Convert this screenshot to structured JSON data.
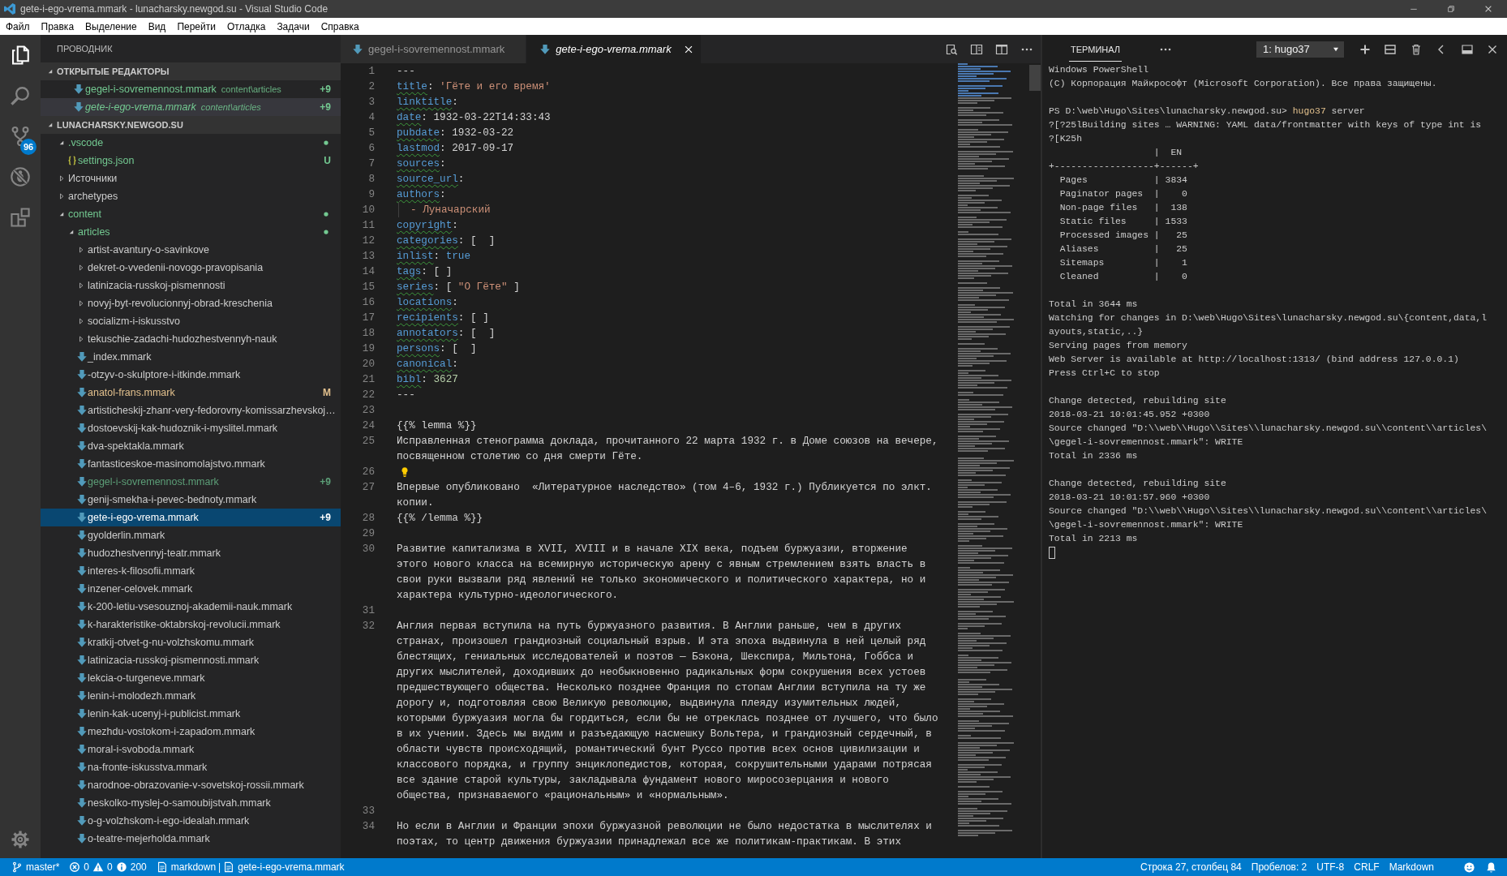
{
  "window": {
    "title": "gete-i-ego-vrema.mmark - lunacharsky.newgod.su - Visual Studio Code"
  },
  "menu": [
    "Файл",
    "Правка",
    "Выделение",
    "Вид",
    "Перейти",
    "Отладка",
    "Задачи",
    "Справка"
  ],
  "activity_bar": {
    "items": [
      {
        "kind": "explorer",
        "selected": true
      },
      {
        "kind": "search",
        "selected": false
      },
      {
        "kind": "scm",
        "selected": false,
        "badge": "96"
      },
      {
        "kind": "debug",
        "selected": false
      },
      {
        "kind": "extensions",
        "selected": false
      }
    ]
  },
  "sidebar": {
    "title": "ПРОВОДНИК",
    "open_editors": {
      "title": "ОТКРЫТЫЕ РЕДАКТОРЫ",
      "expanded": true,
      "items": [
        {
          "label": "gegel-i-sovremennost.mmark",
          "path": "content\\articles",
          "badge": "+9",
          "color": "#73c991",
          "preview": false,
          "selected": false
        },
        {
          "label": "gete-i-ego-vrema.mmark",
          "path": "content\\articles",
          "badge": "+9",
          "color": "#73c991",
          "preview": true,
          "selected": true
        }
      ]
    },
    "project": {
      "title": "LUNACHARSKY.NEWGOD.SU",
      "expanded": true,
      "tree": [
        {
          "label": ".vscode",
          "kind": "folder",
          "expanded": true,
          "dot": true,
          "color": "#73c991",
          "selected": false,
          "children": [
            {
              "label": "settings.json",
              "kind": "json",
              "color": "#73c991",
              "badge": "U",
              "selected": false
            }
          ]
        },
        {
          "label": "Источники",
          "kind": "folder",
          "expanded": false,
          "dot": false,
          "color": "#cccccc",
          "selected": false
        },
        {
          "label": "archetypes",
          "kind": "folder",
          "expanded": false,
          "dot": false,
          "color": "#cccccc",
          "selected": false
        },
        {
          "label": "content",
          "kind": "folder",
          "expanded": true,
          "dot": true,
          "color": "#73c991",
          "selected": false,
          "children": [
            {
              "label": "articles",
              "kind": "folder",
              "expanded": true,
              "dot": true,
              "color": "#73c991",
              "selected": false,
              "children": [
                {
                  "label": "artist-avantury-o-savinkove",
                  "kind": "folder",
                  "expanded": false,
                  "dot": false,
                  "color": "#cccccc",
                  "selected": false
                },
                {
                  "label": "dekret-o-vvedenii-novogo-pravopisania",
                  "kind": "folder",
                  "expanded": false,
                  "dot": false,
                  "color": "#cccccc",
                  "selected": false
                },
                {
                  "label": "latinizacia-russkoj-pismennosti",
                  "kind": "folder",
                  "expanded": false,
                  "dot": false,
                  "color": "#cccccc",
                  "selected": false
                },
                {
                  "label": "novyj-byt-revolucionnyj-obrad-kreschenia",
                  "kind": "folder",
                  "expanded": false,
                  "dot": false,
                  "color": "#cccccc",
                  "selected": false
                },
                {
                  "label": "socializm-i-iskusstvo",
                  "kind": "folder",
                  "expanded": false,
                  "dot": false,
                  "color": "#cccccc",
                  "selected": false
                },
                {
                  "label": "tekuschie-zadachi-hudozhestvennyh-nauk",
                  "kind": "folder",
                  "expanded": false,
                  "dot": false,
                  "color": "#cccccc",
                  "selected": false
                },
                {
                  "label": "_index.mmark",
                  "kind": "markdown",
                  "color": "#cccccc",
                  "selected": false
                },
                {
                  "label": "-otzyv-o-skulptore-i-itkinde.mmark",
                  "kind": "markdown",
                  "color": "#cccccc",
                  "selected": false
                },
                {
                  "label": "anatol-frans.mmark",
                  "kind": "markdown",
                  "color": "#e2c08d",
                  "badge": "M",
                  "selected": false
                },
                {
                  "label": "artisticheskij-zhanr-very-fedorovny-komissarzhevskoj…",
                  "kind": "markdown",
                  "color": "#cccccc",
                  "selected": false
                },
                {
                  "label": "dostoevskij-kak-hudoznik-i-myslitel.mmark",
                  "kind": "markdown",
                  "color": "#cccccc",
                  "selected": false
                },
                {
                  "label": "dva-spektakla.mmark",
                  "kind": "markdown",
                  "color": "#cccccc",
                  "selected": false
                },
                {
                  "label": "fantasticeskoe-masinomolajstvo.mmark",
                  "kind": "markdown",
                  "color": "#cccccc",
                  "selected": false
                },
                {
                  "label": "gegel-i-sovremennost.mmark",
                  "kind": "markdown",
                  "color": "#5c9e77",
                  "badge": "+9",
                  "selected": false
                },
                {
                  "label": "genij-smekha-i-pevec-bednoty.mmark",
                  "kind": "markdown",
                  "color": "#cccccc",
                  "selected": false
                },
                {
                  "label": "gete-i-ego-vrema.mmark",
                  "kind": "markdown",
                  "color": "#ffffff",
                  "badge": "+9",
                  "selected": true
                },
                {
                  "label": "gyolderlin.mmark",
                  "kind": "markdown",
                  "color": "#cccccc",
                  "selected": false
                },
                {
                  "label": "hudozhestvennyj-teatr.mmark",
                  "kind": "markdown",
                  "color": "#cccccc",
                  "selected": false
                },
                {
                  "label": "interes-k-filosofii.mmark",
                  "kind": "markdown",
                  "color": "#cccccc",
                  "selected": false
                },
                {
                  "label": "inzener-celovek.mmark",
                  "kind": "markdown",
                  "color": "#cccccc",
                  "selected": false
                },
                {
                  "label": "k-200-letiu-vsesouznoj-akademii-nauk.mmark",
                  "kind": "markdown",
                  "color": "#cccccc",
                  "selected": false
                },
                {
                  "label": "k-harakteristike-oktabrskoj-revolucii.mmark",
                  "kind": "markdown",
                  "color": "#cccccc",
                  "selected": false
                },
                {
                  "label": "kratkij-otvet-g-nu-volzhskomu.mmark",
                  "kind": "markdown",
                  "color": "#cccccc",
                  "selected": false
                },
                {
                  "label": "latinizacia-russkoj-pismennosti.mmark",
                  "kind": "markdown",
                  "color": "#cccccc",
                  "selected": false
                },
                {
                  "label": "lekcia-o-turgeneve.mmark",
                  "kind": "markdown",
                  "color": "#cccccc",
                  "selected": false
                },
                {
                  "label": "lenin-i-molodezh.mmark",
                  "kind": "markdown",
                  "color": "#cccccc",
                  "selected": false
                },
                {
                  "label": "lenin-kak-ucenyj-i-publicist.mmark",
                  "kind": "markdown",
                  "color": "#cccccc",
                  "selected": false
                },
                {
                  "label": "mezhdu-vostokom-i-zapadom.mmark",
                  "kind": "markdown",
                  "color": "#cccccc",
                  "selected": false
                },
                {
                  "label": "moral-i-svoboda.mmark",
                  "kind": "markdown",
                  "color": "#cccccc",
                  "selected": false
                },
                {
                  "label": "na-fronte-iskusstva.mmark",
                  "kind": "markdown",
                  "color": "#cccccc",
                  "selected": false
                },
                {
                  "label": "narodnoe-obrazovanie-v-sovetskoj-rossii.mmark",
                  "kind": "markdown",
                  "color": "#cccccc",
                  "selected": false
                },
                {
                  "label": "neskolko-myslej-o-samoubijstvah.mmark",
                  "kind": "markdown",
                  "color": "#cccccc",
                  "selected": false
                },
                {
                  "label": "o-g-volzhskom-i-ego-idealah.mmark",
                  "kind": "markdown",
                  "color": "#cccccc",
                  "selected": false
                },
                {
                  "label": "o-teatre-mejerholda.mmark",
                  "kind": "markdown",
                  "color": "#cccccc",
                  "selected": false
                }
              ]
            }
          ]
        }
      ]
    }
  },
  "editor": {
    "tabs": [
      {
        "label": "gegel-i-sovremennost.mmark",
        "selected": false,
        "preview": false
      },
      {
        "label": "gete-i-ego-vrema.mmark",
        "selected": true,
        "preview": true
      }
    ],
    "lines": [
      {
        "number": "1",
        "tokens": [
          {
            "kind": "plain",
            "text": "---"
          }
        ]
      },
      {
        "number": "2",
        "tokens": [
          {
            "kind": "key",
            "text": "title"
          },
          {
            "kind": "plain",
            "text": ": "
          },
          {
            "kind": "string",
            "text": "'Гёте и его время'"
          }
        ]
      },
      {
        "number": "3",
        "tokens": [
          {
            "kind": "key",
            "text": "linktitle"
          },
          {
            "kind": "plain",
            "text": ":"
          }
        ]
      },
      {
        "number": "4",
        "tokens": [
          {
            "kind": "key",
            "text": "date"
          },
          {
            "kind": "plain",
            "text": ": 1932-03-22T14:33:43"
          }
        ]
      },
      {
        "number": "5",
        "tokens": [
          {
            "kind": "key",
            "text": "pubdate"
          },
          {
            "kind": "plain",
            "text": ": 1932-03-22"
          }
        ]
      },
      {
        "number": "6",
        "tokens": [
          {
            "kind": "key",
            "text": "lastmod"
          },
          {
            "kind": "plain",
            "text": ": 2017-09-17"
          }
        ]
      },
      {
        "number": "7",
        "tokens": [
          {
            "kind": "key",
            "text": "sources"
          },
          {
            "kind": "plain",
            "text": ":"
          }
        ]
      },
      {
        "number": "8",
        "tokens": [
          {
            "kind": "key",
            "text": "source_url"
          },
          {
            "kind": "plain",
            "text": ":"
          }
        ]
      },
      {
        "number": "9",
        "tokens": [
          {
            "kind": "key",
            "text": "authors"
          },
          {
            "kind": "plain",
            "text": ":"
          }
        ]
      },
      {
        "number": "10",
        "indent_guide": true,
        "tokens": [
          {
            "kind": "string",
            "text": "- Луначарский"
          }
        ]
      },
      {
        "number": "11",
        "tokens": [
          {
            "kind": "key",
            "text": "copyright"
          },
          {
            "kind": "plain",
            "text": ":"
          }
        ]
      },
      {
        "number": "12",
        "tokens": [
          {
            "kind": "key",
            "text": "categories"
          },
          {
            "kind": "plain",
            "text": ": [  ]"
          }
        ]
      },
      {
        "number": "13",
        "tokens": [
          {
            "kind": "key",
            "text": "inlist"
          },
          {
            "kind": "plain",
            "text": ": "
          },
          {
            "kind": "bool",
            "text": "true"
          }
        ]
      },
      {
        "number": "14",
        "tokens": [
          {
            "kind": "key",
            "text": "tags"
          },
          {
            "kind": "plain",
            "text": ": [ ]"
          }
        ]
      },
      {
        "number": "15",
        "tokens": [
          {
            "kind": "key",
            "text": "series"
          },
          {
            "kind": "plain",
            "text": ": [ "
          },
          {
            "kind": "string",
            "text": "\"О Гёте\""
          },
          {
            "kind": "plain",
            "text": " ]"
          }
        ]
      },
      {
        "number": "16",
        "tokens": [
          {
            "kind": "key",
            "text": "locations"
          },
          {
            "kind": "plain",
            "text": ":"
          }
        ]
      },
      {
        "number": "17",
        "tokens": [
          {
            "kind": "key",
            "text": "recipients"
          },
          {
            "kind": "plain",
            "text": ": [ ]"
          }
        ]
      },
      {
        "number": "18",
        "tokens": [
          {
            "kind": "key",
            "text": "annotators"
          },
          {
            "kind": "plain",
            "text": ": [  ]"
          }
        ]
      },
      {
        "number": "19",
        "tokens": [
          {
            "kind": "key",
            "text": "persons"
          },
          {
            "kind": "plain",
            "text": ": [  ]"
          }
        ]
      },
      {
        "number": "20",
        "tokens": [
          {
            "kind": "key",
            "text": "canonical"
          },
          {
            "kind": "plain",
            "text": ":"
          }
        ]
      },
      {
        "number": "21",
        "tokens": [
          {
            "kind": "key",
            "text": "bibl"
          },
          {
            "kind": "plain",
            "text": ": "
          },
          {
            "kind": "number",
            "text": "3627"
          }
        ]
      },
      {
        "number": "22",
        "tokens": [
          {
            "kind": "plain",
            "text": "---"
          }
        ]
      },
      {
        "number": "23"
      },
      {
        "number": "24",
        "tokens": [
          {
            "kind": "plain",
            "text": "{{% lemma %}}"
          }
        ]
      },
      {
        "number": "25",
        "rows": [
          "Исправленная стенограмма доклада, прочитанного 22 марта 1932 г. в Доме союзов на вечере,",
          "посвященном столетию со дня смерти Гёте."
        ]
      },
      {
        "number": "26",
        "lightbulb": true
      },
      {
        "number": "27",
        "rows": [
          "Впервые опубликовано  «Литературное наследство» (том 4–6, 1932 г.) Публикуется по элкт.",
          "копии."
        ]
      },
      {
        "number": "28",
        "tokens": [
          {
            "kind": "plain",
            "text": "{{% /lemma %}}"
          }
        ]
      },
      {
        "number": "29"
      },
      {
        "number": "30",
        "rows": [
          "Развитие капитализма в XVII, XVIII и в начале XIX века, подъем буржуазии, вторжение",
          "этого нового класса на всемирную историческую арену с явным стремлением взять власть в",
          "свои руки вызвали ряд явлений не только экономического и политического характера, но и",
          "характера культурно-идеологического."
        ]
      },
      {
        "number": "31"
      },
      {
        "number": "32",
        "rows": [
          "Англия первая вступила на путь буржуазного развития. В Англии раньше, чем в других",
          "странах, произошел грандиозный социальный взрыв. И эта эпоха выдвинула в ней целый ряд",
          "блестящих, гениальных исследователей и поэтов — Бэкона, Шекспира, Мильтона, Гоббса и",
          "других мыслителей, доходивших до необыкновенно радикальных форм сокрушения всех устоев",
          "предшествующего общества. Несколько позднее Франция по стопам Англии вступила на ту же",
          "дорогу и, подготовляя свою Великую революцию, выдвинула плеяду изумительных людей,",
          "которыми буржуазия могла бы гордиться, если бы не отреклась позднее от лучшего, что было",
          "в их учении. Здесь мы видим и разъедающую насмешку Вольтера, и грандиозный сердечный, в",
          "области чувств происходящий, романтический бунт Руссо против всех основ цивилизации и",
          "классового порядка, и группу энциклопедистов, которая, сокрушительными ударами потрясая",
          "все здание старой культуры, закладывала фундамент нового миросозерцания и нового",
          "общества, признаваемого «рациональным» и «нормальным»."
        ]
      },
      {
        "number": "33"
      },
      {
        "number": "34",
        "rows": [
          "Но если в Англии и Франции эпохи буржуазной революции не было недостатка в мыслителях и",
          "поэтах, то центр движения буржуазии принадлежал все же политикам-практикам. В этих"
        ]
      }
    ]
  },
  "terminal": {
    "title": "ТЕРМИНАЛ",
    "instance": "1: hugo37",
    "cursor": true,
    "lines": [
      {
        "kind": "output",
        "text": "Windows PowerShell"
      },
      {
        "kind": "output",
        "text": "(C) Корпорация Майкрософт (Microsoft Corporation). Все права защищены."
      },
      {
        "kind": "blank"
      },
      {
        "kind": "prompt",
        "prompt": "PS D:\\web\\Hugo\\Sites\\lunacharsky.newgod.su> ",
        "command": "hugo37",
        "args": " server"
      },
      {
        "kind": "output",
        "text": "?[?25lBuilding sites … WARNING: YAML data/frontmatter with keys of type int is"
      },
      {
        "kind": "output",
        "text": "?[K25h"
      },
      {
        "kind": "output",
        "text": "                   |  EN"
      },
      {
        "kind": "output",
        "text": "+------------------+------+"
      },
      {
        "kind": "output",
        "text": "  Pages            | 3834"
      },
      {
        "kind": "output",
        "text": "  Paginator pages  |    0"
      },
      {
        "kind": "output",
        "text": "  Non-page files   |  138"
      },
      {
        "kind": "output",
        "text": "  Static files     | 1533"
      },
      {
        "kind": "output",
        "text": "  Processed images |   25"
      },
      {
        "kind": "output",
        "text": "  Aliases          |   25"
      },
      {
        "kind": "output",
        "text": "  Sitemaps         |    1"
      },
      {
        "kind": "output",
        "text": "  Cleaned          |    0"
      },
      {
        "kind": "blank"
      },
      {
        "kind": "output",
        "text": "Total in 3644 ms"
      },
      {
        "kind": "output",
        "text": "Watching for changes in D:\\web\\Hugo\\Sites\\lunacharsky.newgod.su\\{content,data,l"
      },
      {
        "kind": "output",
        "text": "ayouts,static,..}"
      },
      {
        "kind": "output",
        "text": "Serving pages from memory"
      },
      {
        "kind": "output",
        "text": "Web Server is available at http://localhost:1313/ (bind address 127.0.0.1)"
      },
      {
        "kind": "output",
        "text": "Press Ctrl+C to stop"
      },
      {
        "kind": "blank"
      },
      {
        "kind": "output",
        "text": "Change detected, rebuilding site"
      },
      {
        "kind": "output",
        "text": "2018-03-21 10:01:45.952 +0300"
      },
      {
        "kind": "output",
        "text": "Source changed \"D:\\\\web\\\\Hugo\\\\Sites\\\\lunacharsky.newgod.su\\\\content\\\\articles\\"
      },
      {
        "kind": "output",
        "text": "\\gegel-i-sovremennost.mmark\": WRITE"
      },
      {
        "kind": "output",
        "text": "Total in 2336 ms"
      },
      {
        "kind": "blank"
      },
      {
        "kind": "output",
        "text": "Change detected, rebuilding site"
      },
      {
        "kind": "output",
        "text": "2018-03-21 10:01:57.960 +0300"
      },
      {
        "kind": "output",
        "text": "Source changed \"D:\\\\web\\\\Hugo\\\\Sites\\\\lunacharsky.newgod.su\\\\content\\\\articles\\"
      },
      {
        "kind": "output",
        "text": "\\gegel-i-sovremennost.mmark\": WRITE"
      },
      {
        "kind": "output",
        "text": "Total in 2213 ms"
      }
    ]
  },
  "status_bar": {
    "branch": "master*",
    "errors": "0",
    "warnings": "0",
    "infos": "200",
    "language_mode": "markdown",
    "separator": "|",
    "file": "gete-i-ego-vrema.mmark",
    "position": "Строка 27, столбец 84",
    "indent": "Пробелов: 2",
    "encoding": "UTF-8",
    "eol": "CRLF",
    "language": "Markdown"
  }
}
